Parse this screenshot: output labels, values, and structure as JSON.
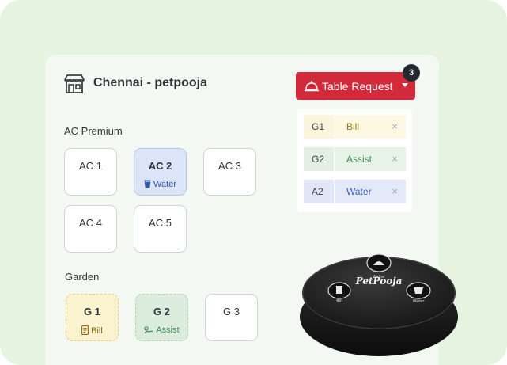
{
  "store": {
    "name": "Chennai - petpooja",
    "icon": "store-icon"
  },
  "table_request": {
    "label": "Table Request",
    "count": "3",
    "icon": "bell-icon"
  },
  "requests": [
    {
      "table": "G1",
      "type": "Bill",
      "dismiss": "×"
    },
    {
      "table": "G2",
      "type": "Assist",
      "dismiss": "×"
    },
    {
      "table": "A2",
      "type": "Water",
      "dismiss": "×"
    }
  ],
  "sections": [
    {
      "title": "AC Premium",
      "tables": [
        {
          "name": "AC 1",
          "request": ""
        },
        {
          "name": "AC 2",
          "request": "Water",
          "request_icon": "water-glass-icon"
        },
        {
          "name": "AC 3",
          "request": ""
        },
        {
          "name": "AC 4",
          "request": ""
        },
        {
          "name": "AC 5",
          "request": ""
        }
      ]
    },
    {
      "title": "Garden",
      "tables": [
        {
          "name": "G 1",
          "request": "Bill",
          "request_icon": "bill-icon"
        },
        {
          "name": "G 2",
          "request": "Assist",
          "request_icon": "assist-icon"
        },
        {
          "name": "G 3",
          "request": ""
        }
      ]
    }
  ],
  "device": {
    "brand": "PetPooja",
    "buttons": [
      "Waiter",
      "Bill",
      "Water"
    ]
  },
  "colors": {
    "accent": "#d22a3a",
    "background": "#e6f3e1",
    "badge": "#222a2f"
  }
}
